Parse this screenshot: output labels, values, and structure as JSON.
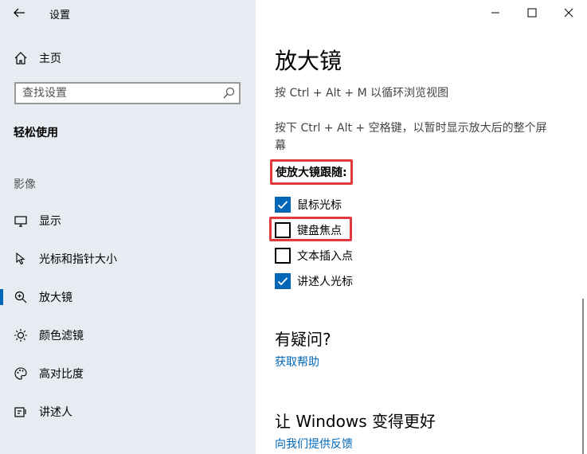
{
  "window": {
    "app_title": "设置"
  },
  "sidebar": {
    "home_label": "主页",
    "search_placeholder": "查找设置",
    "section_title": "轻松使用",
    "group_label": "影像",
    "items": [
      {
        "label": "显示",
        "icon": "monitor-icon"
      },
      {
        "label": "光标和指针大小",
        "icon": "pointer-icon"
      },
      {
        "label": "放大镜",
        "icon": "magnifier-icon",
        "active": true
      },
      {
        "label": "颜色滤镜",
        "icon": "brightness-icon"
      },
      {
        "label": "高对比度",
        "icon": "palette-icon"
      },
      {
        "label": "讲述人",
        "icon": "narrator-icon"
      }
    ]
  },
  "main": {
    "title": "放大镜",
    "desc1": "按 Ctrl + Alt + M 以循环浏览视图",
    "desc2": "按下 Ctrl + Alt + 空格键，以暂时显示放大后的整个屏幕",
    "follow_label": "使放大镜跟随:",
    "checkboxes": [
      {
        "label": "鼠标光标",
        "checked": true
      },
      {
        "label": "键盘焦点",
        "checked": false
      },
      {
        "label": "文本插入点",
        "checked": false
      },
      {
        "label": "讲述人光标",
        "checked": true
      }
    ],
    "question_title": "有疑问?",
    "help_link": "获取帮助",
    "better_title": "让 Windows 变得更好",
    "feedback_link": "向我们提供反馈"
  },
  "colors": {
    "accent": "#0067b8",
    "highlight": "#e03a3e",
    "sidebar_bg": "#e6ecf1"
  }
}
